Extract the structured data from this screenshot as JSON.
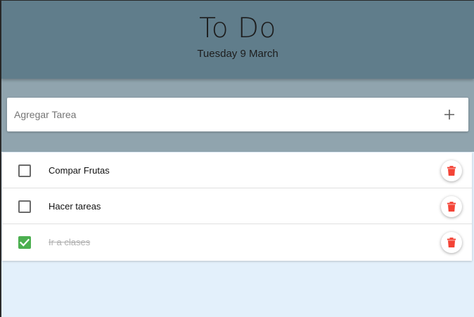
{
  "header": {
    "title": "To Do",
    "date": "Tuesday 9 March"
  },
  "new_task": {
    "placeholder": "Agregar Tarea",
    "value": "",
    "add_icon": "plus-icon"
  },
  "tasks": [
    {
      "label": "Compar Frutas",
      "completed": false
    },
    {
      "label": "Hacer tareas",
      "completed": false
    },
    {
      "label": "Ir a clases",
      "completed": true
    }
  ],
  "icons": {
    "delete": "trash-icon",
    "check": "check-icon"
  },
  "colors": {
    "header_bg": "#607d8b",
    "input_band_bg": "#90a4ae",
    "page_bg": "#e3f0fb",
    "checked": "#4caf50",
    "delete": "#f44336"
  }
}
